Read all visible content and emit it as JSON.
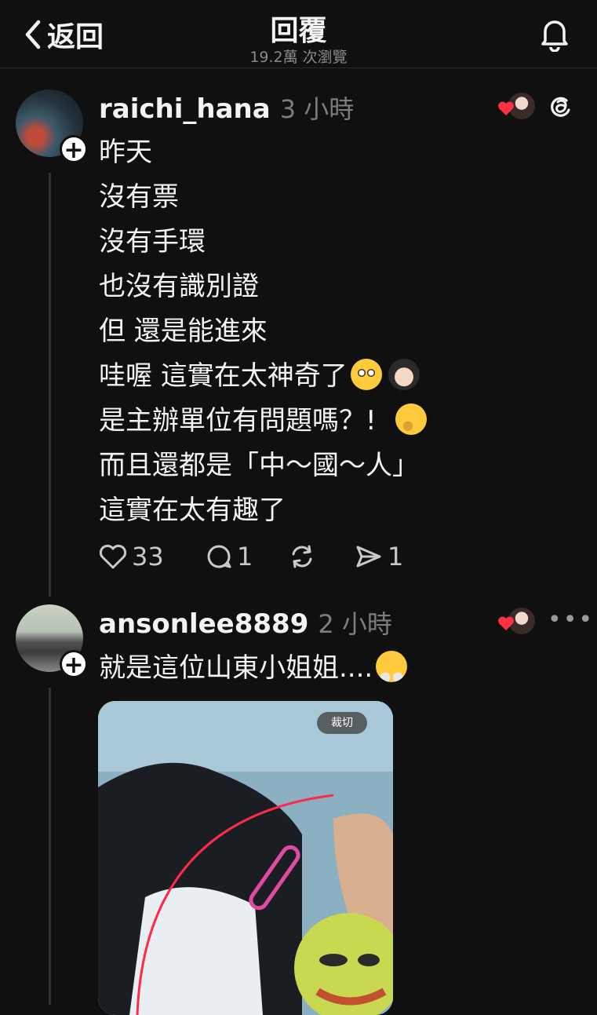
{
  "header": {
    "back_label": "返回",
    "title": "回覆",
    "views": "19.2萬 次瀏覽"
  },
  "posts": [
    {
      "username": "raichi_hana",
      "time": "3 小時",
      "lines": [
        "昨天",
        "沒有票",
        "沒有手環",
        "也沒有識別證",
        "但 還是能進來",
        "哇喔 這實在太神奇了",
        "是主辦單位有問題嗎？!",
        "而且還都是「中～國～人」",
        "這實在太有趣了"
      ],
      "emojis": {
        "line6": [
          "flushed-face-emoji",
          "woman-emoji"
        ],
        "line7": [
          "thinking-face-emoji"
        ]
      },
      "likes": "33",
      "replies": "1",
      "shares": "1"
    },
    {
      "username": "ansonlee8889",
      "time": "2 小時",
      "text": "就是這位山東小姐姐....",
      "emoji": "steam-from-nose-emoji",
      "media_badge": "裁切"
    }
  ],
  "colors": {
    "background": "#101010",
    "text": "#f3f3f3",
    "muted": "#7d7d7d",
    "like_red": "#ff3040"
  },
  "icons": [
    "chevron-left-icon",
    "bell-icon",
    "threads-logo-icon",
    "heart-icon",
    "comment-icon",
    "repost-icon",
    "send-icon",
    "more-icon"
  ]
}
